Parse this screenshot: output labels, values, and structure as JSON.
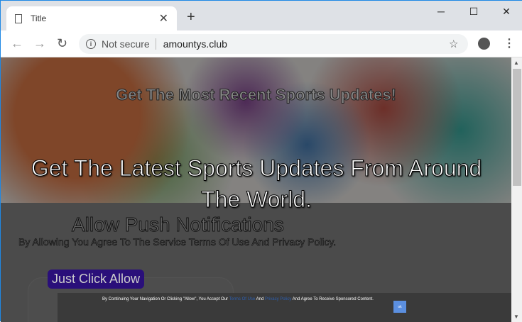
{
  "browser": {
    "tab_title": "Title",
    "security_label": "Not secure",
    "url": "amountys.club"
  },
  "page": {
    "heading_top": "Get The Most Recent Sports Updates!",
    "heading_main": "Get The Latest Sports Updates From Around The World.",
    "push_title": "Allow Push Notifications",
    "agree_text": "By Allowing You Agree To The Service Terms Of Use And Privacy Policy.",
    "allow_button": "Just Click Allow",
    "cookie": {
      "prefix": "By Continuing Your Navigation Or Clicking \"Allow\", You Accept Our",
      "terms_link": "Terms Of Use",
      "and": "And",
      "privacy_link": "Privacy Policy",
      "suffix": "And Agree To Receive Sponsored Content.",
      "ok": "ok"
    }
  }
}
